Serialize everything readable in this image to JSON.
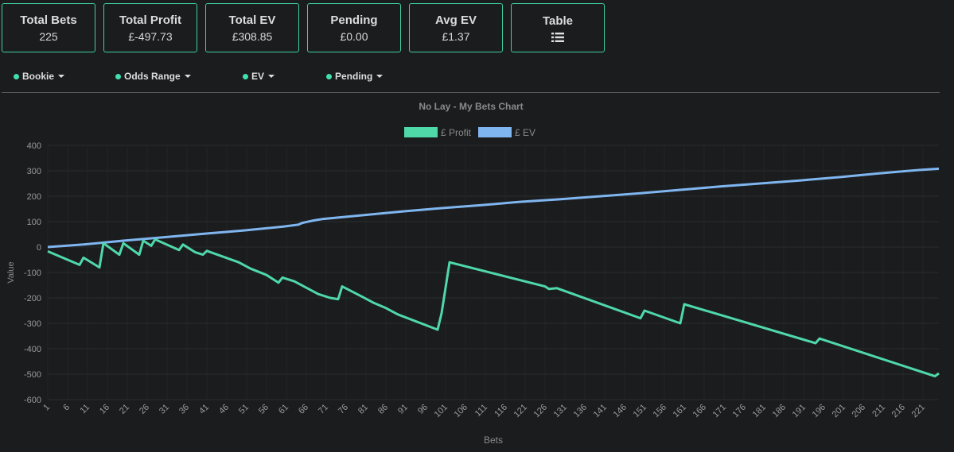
{
  "stats": [
    {
      "label": "Total Bets",
      "value": "225"
    },
    {
      "label": "Total Profit",
      "value": "£-497.73"
    },
    {
      "label": "Total EV",
      "value": "£308.85"
    },
    {
      "label": "Pending",
      "value": "£0.00"
    },
    {
      "label": "Avg EV",
      "value": "£1.37"
    },
    {
      "label": "Table",
      "icon": "list-icon"
    }
  ],
  "filters": [
    {
      "label": "Bookie"
    },
    {
      "label": "Odds Range"
    },
    {
      "label": "EV"
    },
    {
      "label": "Pending"
    }
  ],
  "chart_data": {
    "type": "line",
    "title": "No Lay - My Bets Chart",
    "xlabel": "Bets",
    "ylabel": "Value",
    "ylim": [
      -600,
      400
    ],
    "yticks": [
      400,
      300,
      200,
      100,
      0,
      -100,
      -200,
      -300,
      -400,
      -500,
      -600
    ],
    "x_range": [
      1,
      225
    ],
    "x_tick_step": 5,
    "legend_position": "top-center",
    "series": [
      {
        "name": "£ Profit",
        "color": "#4fd8a8",
        "points": [
          [
            1,
            -17
          ],
          [
            9,
            -70
          ],
          [
            10,
            -42
          ],
          [
            14,
            -80
          ],
          [
            15,
            15
          ],
          [
            19,
            -30
          ],
          [
            20,
            15
          ],
          [
            24,
            -30
          ],
          [
            25,
            25
          ],
          [
            27,
            5
          ],
          [
            28,
            30
          ],
          [
            34,
            -12
          ],
          [
            35,
            10
          ],
          [
            38,
            -20
          ],
          [
            40,
            -30
          ],
          [
            41,
            -15
          ],
          [
            49,
            -60
          ],
          [
            52,
            -85
          ],
          [
            56,
            -110
          ],
          [
            58,
            -130
          ],
          [
            59,
            -140
          ],
          [
            60,
            -120
          ],
          [
            63,
            -135
          ],
          [
            66,
            -160
          ],
          [
            69,
            -185
          ],
          [
            72,
            -200
          ],
          [
            74,
            -205
          ],
          [
            75,
            -155
          ],
          [
            80,
            -195
          ],
          [
            83,
            -220
          ],
          [
            86,
            -240
          ],
          [
            89,
            -265
          ],
          [
            99,
            -325
          ],
          [
            100,
            -260
          ],
          [
            102,
            -60
          ],
          [
            126,
            -155
          ],
          [
            127,
            -165
          ],
          [
            129,
            -162
          ],
          [
            150,
            -280
          ],
          [
            151,
            -250
          ],
          [
            160,
            -300
          ],
          [
            161,
            -225
          ],
          [
            194,
            -378
          ],
          [
            195,
            -360
          ],
          [
            224,
            -508
          ],
          [
            225,
            -497
          ]
        ]
      },
      {
        "name": "£ EV",
        "color": "#7fb6ef",
        "points": [
          [
            1,
            0
          ],
          [
            10,
            10
          ],
          [
            20,
            25
          ],
          [
            30,
            38
          ],
          [
            40,
            52
          ],
          [
            50,
            65
          ],
          [
            60,
            80
          ],
          [
            64,
            88
          ],
          [
            65,
            95
          ],
          [
            68,
            105
          ],
          [
            70,
            110
          ],
          [
            80,
            125
          ],
          [
            90,
            140
          ],
          [
            100,
            153
          ],
          [
            110,
            165
          ],
          [
            120,
            178
          ],
          [
            130,
            188
          ],
          [
            140,
            200
          ],
          [
            150,
            212
          ],
          [
            160,
            225
          ],
          [
            170,
            238
          ],
          [
            180,
            250
          ],
          [
            190,
            262
          ],
          [
            200,
            275
          ],
          [
            210,
            290
          ],
          [
            220,
            303
          ],
          [
            225,
            308
          ]
        ]
      }
    ]
  }
}
